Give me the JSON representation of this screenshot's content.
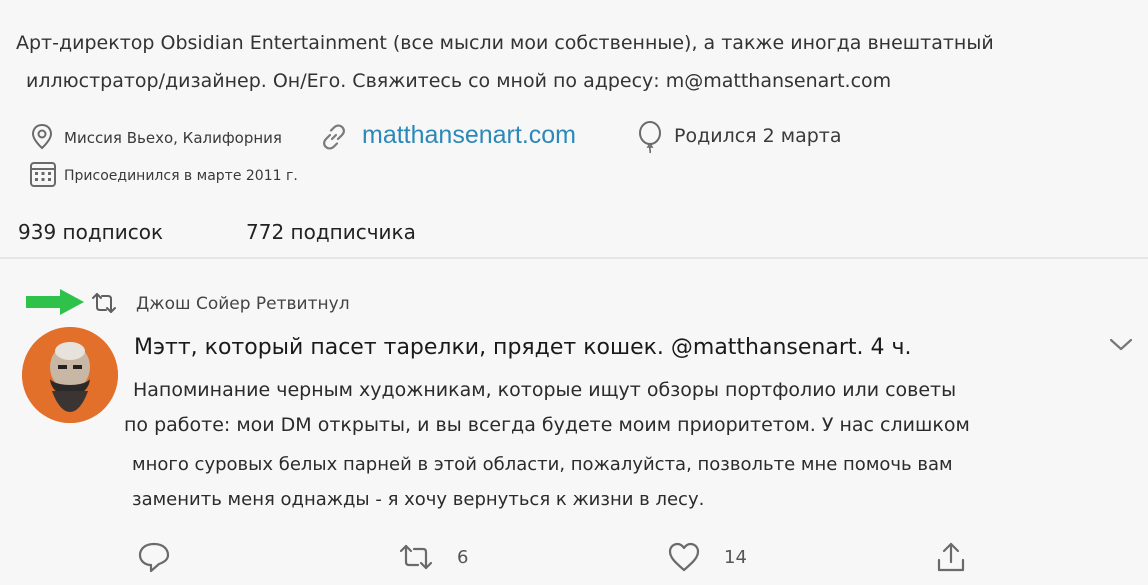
{
  "profile": {
    "bio_line1": "Арт-директор Obsidian Entertainment (все мысли мои собственные), а также иногда внештатный",
    "bio_line2": "иллюстратор/дизайнер. Он/Его. Свяжитесь со мной по адресу: m@matthansenart.com",
    "location": "Миссия Вьехо, Калифорния",
    "website": "matthansenart.com",
    "birthday": "Родился 2 марта",
    "joined": "Присоединился в марте 2011 г.",
    "following": "939 подписок",
    "followers": "772 подписчика"
  },
  "tweet": {
    "retweet_label": "Джош Сойер Ретвитнул",
    "author_line": "Мэтт, который пасет тарелки, прядет кошек. @matthansenart. 4 ч.",
    "body_lines": [
      "Напоминание черным художникам, которые ищут обзоры портфолио или советы",
      "по работе: мои DM открыты, и вы всегда будете моим приоритетом. У нас слишком",
      "много суровых белых парней в этой области, пожалуйста, позвольте мне помочь вам",
      "заменить меня однажды - я хочу вернуться к жизни в лесу."
    ],
    "retweet_count": "6",
    "like_count": "14"
  },
  "colors": {
    "arrow": "#2fc24a",
    "link": "#2b88b8",
    "avatar_bg": "#e2702a"
  },
  "icons": [
    "location-icon",
    "link-icon",
    "balloon-icon",
    "calendar-icon",
    "retweet-icon",
    "reply-icon",
    "like-icon",
    "share-icon",
    "chevron-down-icon",
    "green-arrow-icon"
  ]
}
